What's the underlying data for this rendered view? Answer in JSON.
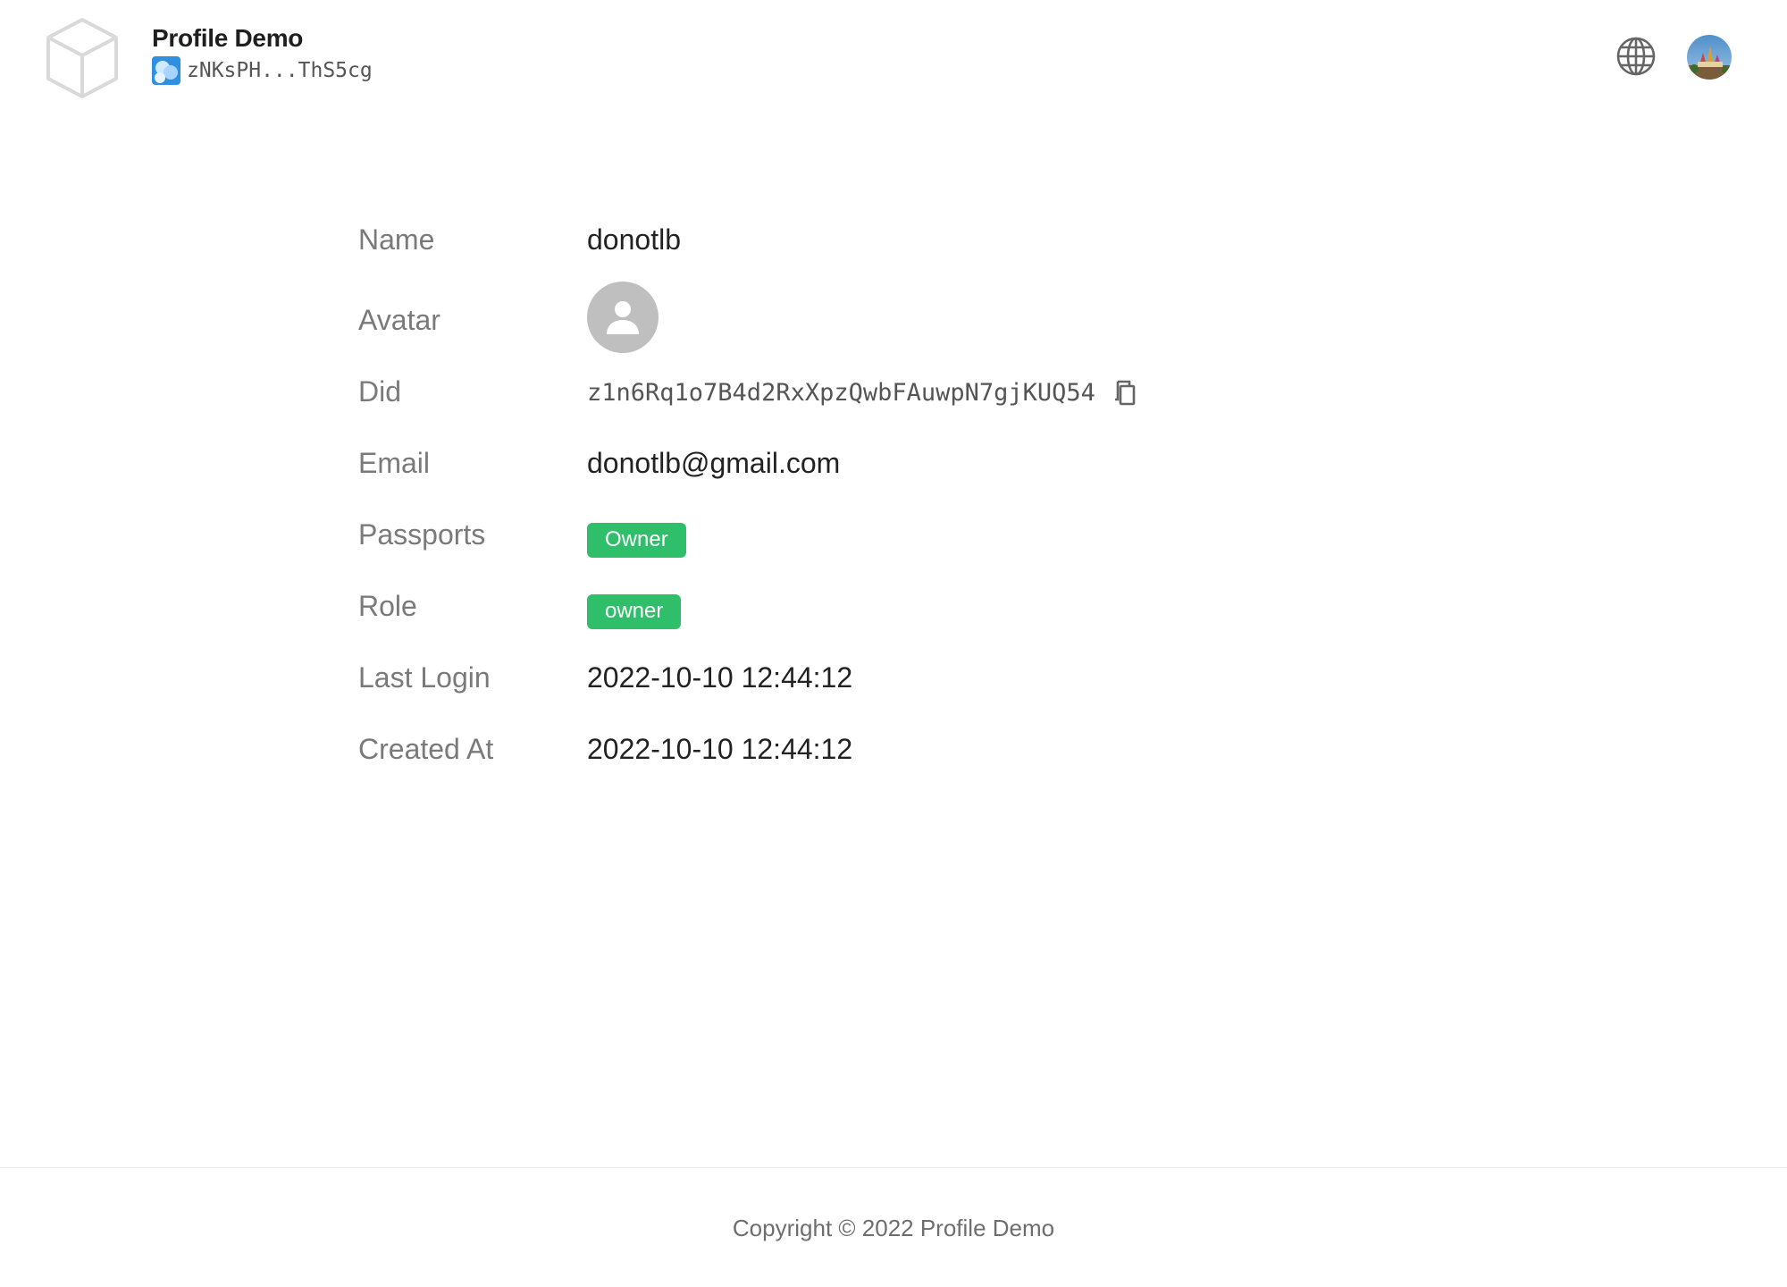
{
  "header": {
    "app_title": "Profile Demo",
    "app_did_short": "zNKsPH...ThS5cg",
    "icons": [
      "cube-logo-icon",
      "globe-icon",
      "user-avatar"
    ]
  },
  "profile": {
    "fields": [
      {
        "label": "Name",
        "value": "donotlb"
      },
      {
        "label": "Avatar",
        "value": ""
      },
      {
        "label": "Did",
        "value": "z1n6Rq1o7B4d2RxXpzQwbFAuwpN7gjKUQ54"
      },
      {
        "label": "Email",
        "value": "donotlb@gmail.com"
      },
      {
        "label": "Passports",
        "value": "Owner"
      },
      {
        "label": "Role",
        "value": "owner"
      },
      {
        "label": "Last Login",
        "value": "2022-10-10 12:44:12"
      },
      {
        "label": "Created At",
        "value": "2022-10-10 12:44:12"
      }
    ]
  },
  "footer": {
    "copyright": "Copyright © 2022 Profile Demo"
  },
  "colors": {
    "badge_green": "#2fbe6a",
    "label_gray": "#7a7a7a",
    "avatar_placeholder": "#bfbfbf"
  }
}
